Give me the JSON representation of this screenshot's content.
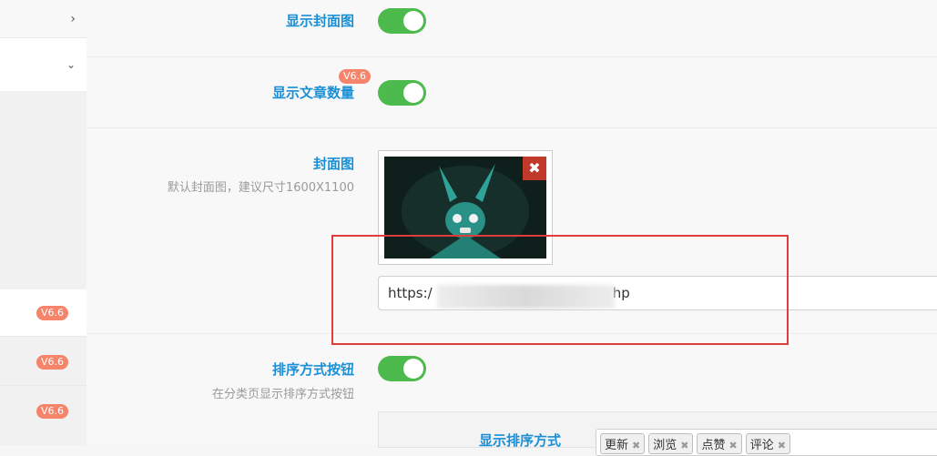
{
  "sidebar": {
    "badges": [
      "V6.6",
      "V6.6",
      "V6.6"
    ]
  },
  "settings": {
    "show_cover": {
      "label": "显示封面图",
      "enabled": true
    },
    "show_post_count": {
      "label": "显示文章数量",
      "badge": "V6.6",
      "enabled": true
    },
    "cover_image": {
      "label": "封面图",
      "description": "默认封面图，建议尺寸1600X1100",
      "url_start": "https:/",
      "url_end": "hp",
      "remove_icon": "✖"
    },
    "sort_buttons": {
      "label": "排序方式按钮",
      "description": "在分类页显示排序方式按钮",
      "enabled": true
    },
    "sort_options": {
      "label": "显示排序方式",
      "tags": [
        "更新",
        "浏览",
        "点赞",
        "评论"
      ]
    }
  },
  "colors": {
    "accent": "#1a8fd6",
    "toggle_on": "#4cba4c",
    "badge": "#f5846a",
    "highlight": "#e03c3c"
  }
}
